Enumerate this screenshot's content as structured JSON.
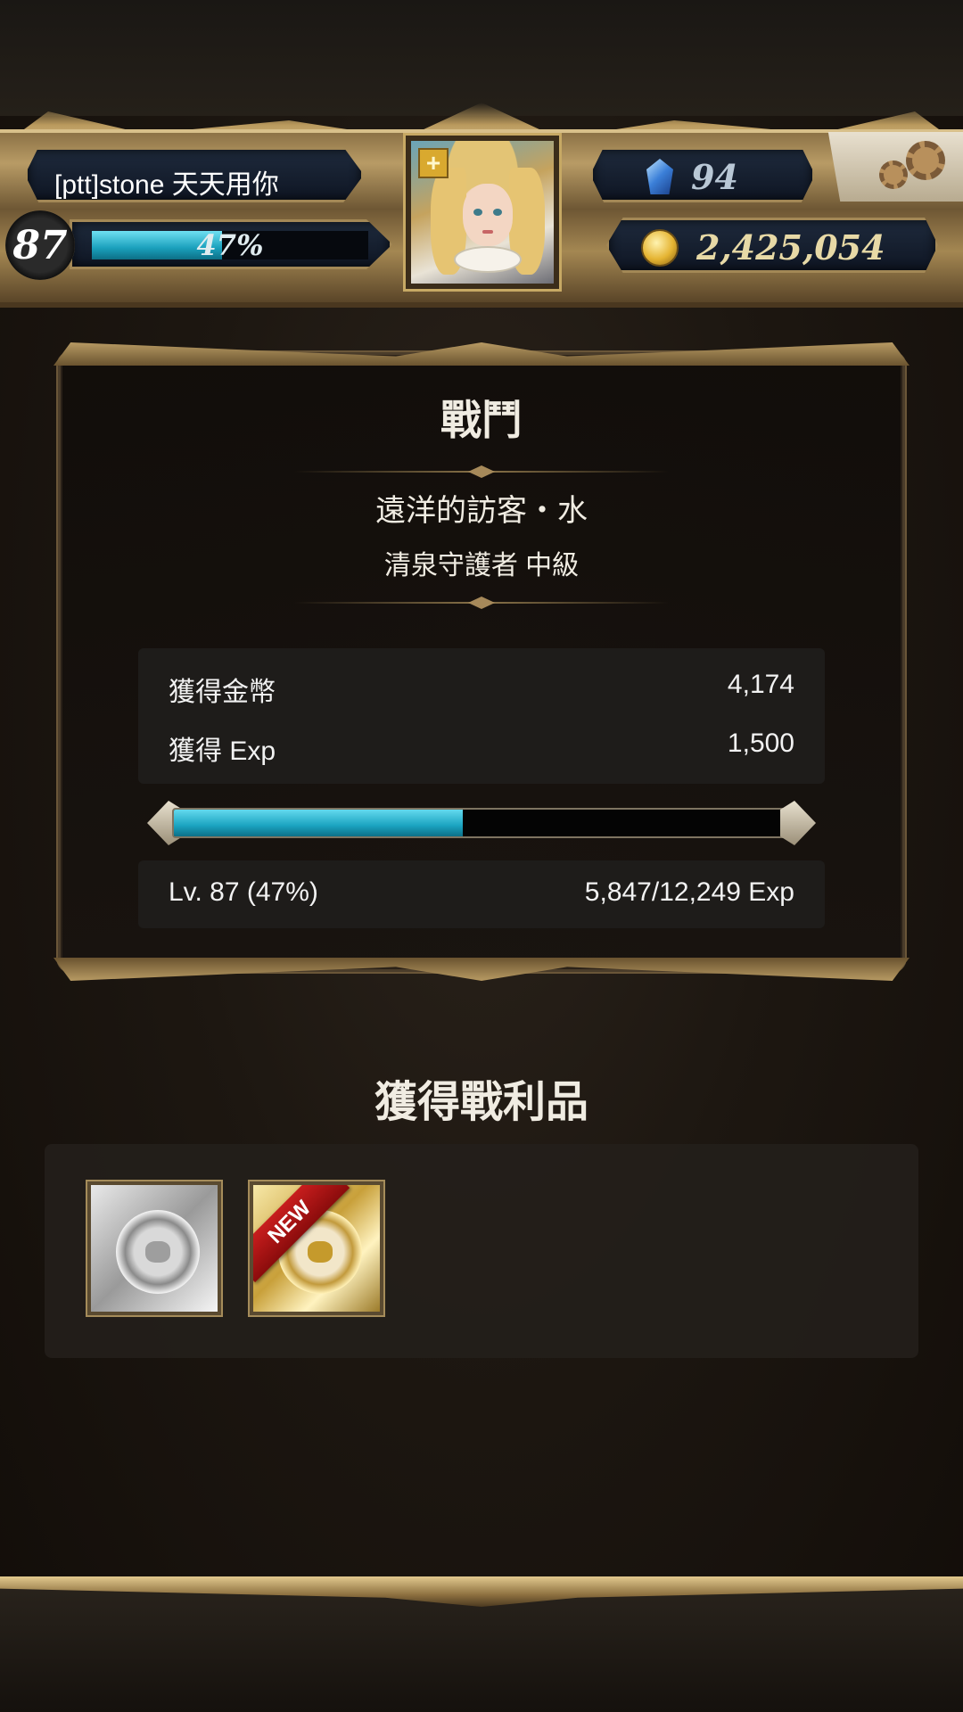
{
  "player": {
    "name": "[ptt]stone 天天用你",
    "level": "87",
    "exp_percent_text": "47%",
    "exp_fraction": 0.47
  },
  "currency": {
    "gems": "94",
    "gold": "2,425,054"
  },
  "icons": {
    "settings": "gear-icon",
    "gem": "gem-icon",
    "gold": "coin-icon",
    "avatar_badge": "cross-icon"
  },
  "avatar": {
    "badge_symbol": "+"
  },
  "battle": {
    "title": "戰鬥",
    "quest_name": "遠洋的訪客・水",
    "quest_level": "清泉守護者 中級",
    "rewards": [
      {
        "label": "獲得金幣",
        "value": "4,174"
      },
      {
        "label": "獲得 Exp",
        "value": "1,500"
      }
    ],
    "level_progress_fraction": 0.47,
    "level_text": "Lv. 87 (47%)",
    "exp_text": "5,847/12,249 Exp"
  },
  "loot": {
    "title": "獲得戰利品",
    "items": [
      {
        "name": "silver-medal-card",
        "is_new": false
      },
      {
        "name": "gold-medal-card",
        "is_new": true,
        "badge": "NEW"
      }
    ]
  },
  "colors": {
    "exp_bar": "#1aa0bc",
    "gold_frame": "#b89b65",
    "new_badge": "#c81d1d"
  }
}
